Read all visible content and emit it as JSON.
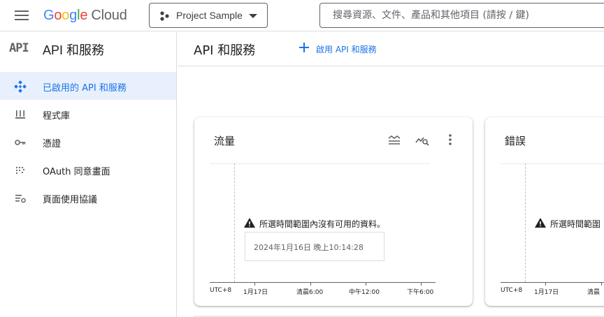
{
  "topbar": {
    "logo_google": [
      "G",
      "o",
      "o",
      "g",
      "l",
      "e"
    ],
    "logo_cloud": "Cloud",
    "project_name": "Project Sample",
    "search_placeholder": "搜尋資源、文件、產品和其他項目 (請按 / 鍵)"
  },
  "sidebar": {
    "icon_text": "API",
    "title": "API 和服務",
    "items": [
      {
        "label": "已啟用的 API 和服務",
        "icon": "enabled-apis-icon",
        "active": true
      },
      {
        "label": "程式庫",
        "icon": "library-icon",
        "active": false
      },
      {
        "label": "憑證",
        "icon": "key-icon",
        "active": false
      },
      {
        "label": "OAuth 同意畫面",
        "icon": "oauth-icon",
        "active": false
      },
      {
        "label": "頁面使用協議",
        "icon": "page-usage-icon",
        "active": false
      }
    ]
  },
  "main": {
    "title": "API 和服務",
    "enable_button": "啟用 API 和服務",
    "cards": [
      {
        "title": "流量",
        "no_data": "所選時間範圍內沒有可用的資料。",
        "tooltip": "2024年1月16日 晚上10:14:28",
        "timezone": "UTC+8",
        "ticks": [
          "1月17日",
          "清晨6:00",
          "中午12:00",
          "下午6:00"
        ]
      },
      {
        "title": "錯誤",
        "no_data": "所選時間範圍",
        "timezone": "UTC+8",
        "ticks": [
          "1月17日",
          "清晨"
        ]
      }
    ]
  },
  "colors": {
    "accent": "#1a73e8",
    "active_bg": "#e8f0fe",
    "border": "#dadce0"
  }
}
